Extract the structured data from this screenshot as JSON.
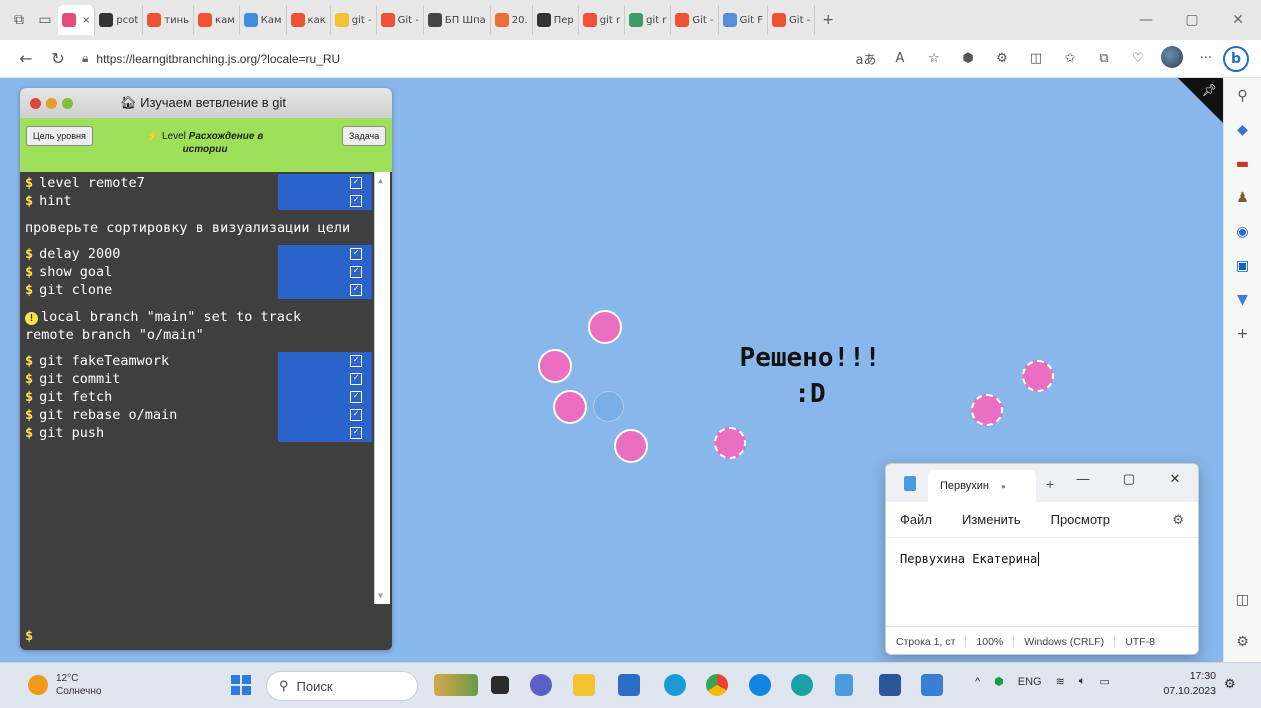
{
  "browser": {
    "tabs": [
      {
        "label": "",
        "color": "#e44d7a",
        "active": true,
        "close": "×"
      },
      {
        "label": "pcot",
        "color": "#333333"
      },
      {
        "label": "тинь",
        "color": "#ef5336"
      },
      {
        "label": "кам",
        "color": "#ef5336"
      },
      {
        "label": "Кам",
        "color": "#3d8ee0"
      },
      {
        "label": "как",
        "color": "#ef5336"
      },
      {
        "label": "git -",
        "color": "#f3c233"
      },
      {
        "label": "Git -",
        "color": "#f05033"
      },
      {
        "label": "БП Шпа",
        "color": "#444444"
      },
      {
        "label": "20.",
        "color": "#e86f3b"
      },
      {
        "label": "Пер",
        "color": "#333333"
      },
      {
        "label": "git r",
        "color": "#ef5336"
      },
      {
        "label": "git r",
        "color": "#3c9c63"
      },
      {
        "label": "Git -",
        "color": "#f05033"
      },
      {
        "label": "Git F",
        "color": "#5a8fd6"
      },
      {
        "label": "Git -",
        "color": "#f05033"
      }
    ],
    "new_tab": "+",
    "url": "https://learngitbranching.js.org/?locale=ru_RU",
    "window_controls": [
      "—",
      "▢",
      "✕"
    ]
  },
  "panel": {
    "title": "Изучаем ветвление в git",
    "goal_button": "Цель уровня",
    "task_button": "Задача",
    "level_prefix": "Level",
    "level_name": "Расхождение в истории"
  },
  "terminal": {
    "group1": [
      "level remote7",
      "hint"
    ],
    "hint_text": "проверьте сортировку в визуализации цели",
    "group2": [
      "delay 2000",
      "show goal",
      "git clone"
    ],
    "info_line1": "local branch \"main\" set to track",
    "info_line2": "remote branch \"o/main\"",
    "group3": [
      "git fakeTeamwork",
      "git commit",
      "git fetch",
      "git rebase o/main",
      "git push"
    ],
    "prompt": "$"
  },
  "viz": {
    "solved_line1": "Решено!!!",
    "solved_line2": ":D"
  },
  "notepad": {
    "tab_title": "Первухин",
    "menu": [
      "Файл",
      "Изменить",
      "Просмотр"
    ],
    "content": "Первухина Екатерина",
    "status": [
      "Строка 1, ст",
      "100%",
      "Windows (CRLF)",
      "UTF-8"
    ]
  },
  "taskbar": {
    "temp": "12°C",
    "weather": "Солнечно",
    "search_placeholder": "Поиск",
    "lang": "ENG",
    "time": "17:30",
    "date": "07.10.2023"
  }
}
